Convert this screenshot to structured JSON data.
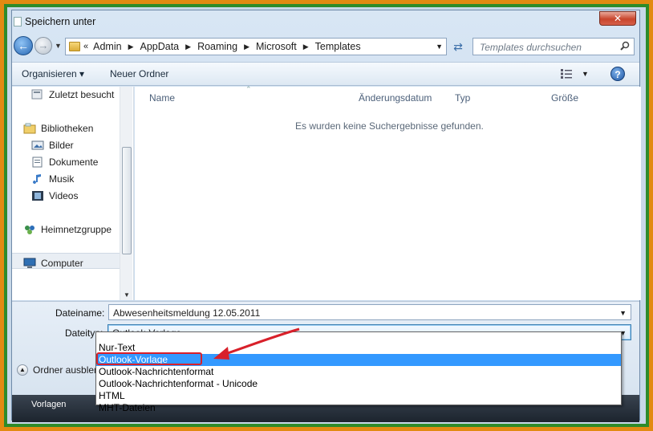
{
  "window": {
    "title": "Speichern unter",
    "close_label": "✕"
  },
  "nav": {
    "back_icon": "back-arrow-icon",
    "forward_icon": "forward-arrow-icon",
    "breadcrumb_lead": "«",
    "breadcrumbs": [
      "Admin",
      "AppData",
      "Roaming",
      "Microsoft",
      "Templates"
    ],
    "search_placeholder": "Templates durchsuchen"
  },
  "toolbar": {
    "organize_label": "Organisieren ▾",
    "new_folder_label": "Neuer Ordner",
    "help_label": "?"
  },
  "sidebar": {
    "items": [
      {
        "label": "Zuletzt besucht",
        "icon": "recent-places-icon"
      },
      {
        "label": "Bibliotheken",
        "icon": "libraries-icon"
      },
      {
        "label": "Bilder",
        "icon": "pictures-icon"
      },
      {
        "label": "Dokumente",
        "icon": "documents-icon"
      },
      {
        "label": "Musik",
        "icon": "music-icon"
      },
      {
        "label": "Videos",
        "icon": "videos-icon"
      },
      {
        "label": "Heimnetzgruppe",
        "icon": "homegroup-icon"
      },
      {
        "label": "Computer",
        "icon": "computer-icon"
      }
    ]
  },
  "content": {
    "columns": [
      "Name",
      "Änderungsdatum",
      "Typ",
      "Größe"
    ],
    "empty_message": "Es wurden keine Suchergebnisse gefunden."
  },
  "form": {
    "filename_label": "Dateiname:",
    "filename_value": "Abwesenheitsmeldung 12.05.2011",
    "filetype_label": "Dateityp:",
    "filetype_value": "Outlook-Vorlage",
    "hide_folders_label": "Ordner ausblende",
    "taskbar_text": "Vorlagen"
  },
  "dropdown": {
    "options": [
      "Nur-Text",
      "Outlook-Vorlage",
      "Outlook-Nachrichtenformat",
      "Outlook-Nachrichtenformat - Unicode",
      "HTML",
      "MHT-Dateien"
    ],
    "selected_index": 1
  },
  "colors": {
    "outer_frame": "#e28a12",
    "inner_frame": "#2e8b2a",
    "selection": "#3399ff",
    "highlight_box": "#d8202a"
  }
}
